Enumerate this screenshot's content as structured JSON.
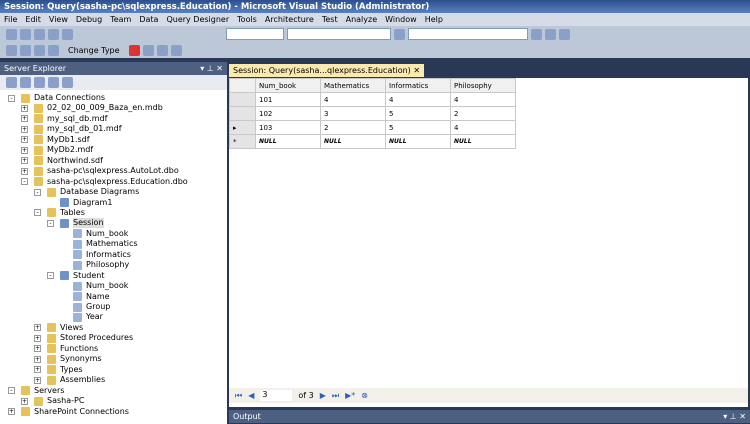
{
  "title": "Session: Query(sasha-pc\\sqlexpress.Education) - Microsoft Visual Studio (Administrator)",
  "menu": [
    "File",
    "Edit",
    "View",
    "Debug",
    "Team",
    "Data",
    "Query Designer",
    "Tools",
    "Architecture",
    "Test",
    "Analyze",
    "Window",
    "Help"
  ],
  "toolbar": {
    "change_type": "Change Type"
  },
  "server_explorer": {
    "title": "Server Explorer",
    "tree": [
      [
        "Data Connections",
        0,
        "-"
      ],
      [
        "02_02_00_009_Baza_en.mdb",
        1,
        "+"
      ],
      [
        "my_sql_db.mdf",
        1,
        "+"
      ],
      [
        "my_sql_db_01.mdf",
        1,
        "+"
      ],
      [
        "MyDb1.sdf",
        1,
        "+"
      ],
      [
        "MyDb2.mdf",
        1,
        "+"
      ],
      [
        "Northwind.sdf",
        1,
        "+"
      ],
      [
        "sasha-pc\\sqlexpress.AutoLot.dbo",
        1,
        "+"
      ],
      [
        "sasha-pc\\sqlexpress.Education.dbo",
        1,
        "-"
      ],
      [
        "Database Diagrams",
        2,
        "-"
      ],
      [
        "Diagram1",
        3,
        ""
      ],
      [
        "Tables",
        2,
        "-"
      ],
      [
        "Session",
        3,
        "-"
      ],
      [
        "Num_book",
        4,
        ""
      ],
      [
        "Mathematics",
        4,
        ""
      ],
      [
        "Informatics",
        4,
        ""
      ],
      [
        "Philosophy",
        4,
        ""
      ],
      [
        "Student",
        3,
        "-"
      ],
      [
        "Num_book",
        4,
        ""
      ],
      [
        "Name",
        4,
        ""
      ],
      [
        "Group",
        4,
        ""
      ],
      [
        "Year",
        4,
        ""
      ],
      [
        "Views",
        2,
        "+"
      ],
      [
        "Stored Procedures",
        2,
        "+"
      ],
      [
        "Functions",
        2,
        "+"
      ],
      [
        "Synonyms",
        2,
        "+"
      ],
      [
        "Types",
        2,
        "+"
      ],
      [
        "Assemblies",
        2,
        "+"
      ],
      [
        "Servers",
        0,
        "-"
      ],
      [
        "Sasha-PC",
        1,
        "+"
      ],
      [
        "SharePoint Connections",
        0,
        "+"
      ]
    ]
  },
  "document": {
    "tab": "Session: Query(sasha...qlexpress.Education)",
    "columns": [
      "Num_book",
      "Mathematics",
      "Informatics",
      "Philosophy"
    ],
    "rows": [
      [
        "",
        "101",
        "4",
        "4",
        "4"
      ],
      [
        "",
        "102",
        "3",
        "5",
        "2"
      ],
      [
        "▸",
        "103",
        "2",
        "5",
        "4"
      ],
      [
        "*",
        "NULL",
        "NULL",
        "NULL",
        "NULL"
      ]
    ]
  },
  "navigator": {
    "page": "3",
    "of": "of 3"
  },
  "output": {
    "title": "Output"
  }
}
